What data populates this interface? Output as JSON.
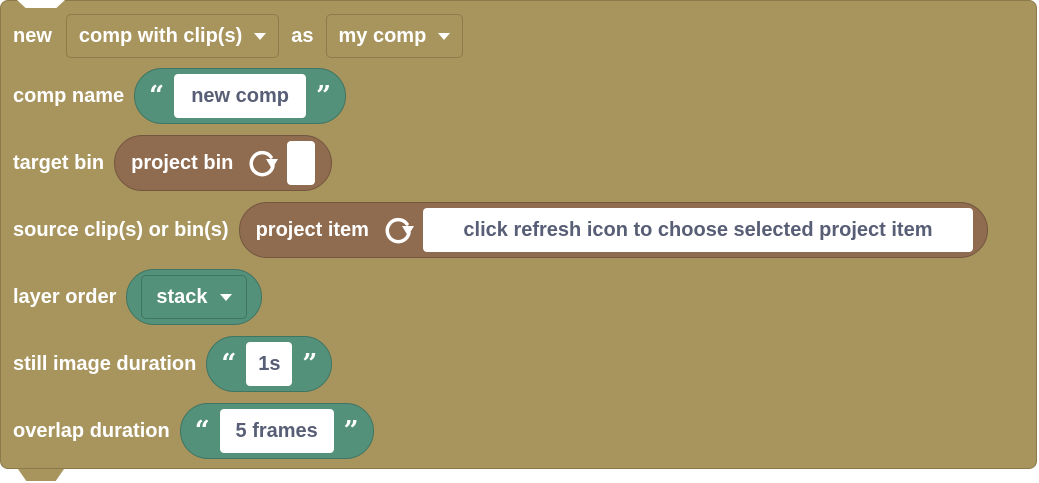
{
  "block": {
    "prefix": "new",
    "comp_type": "comp with clip(s)",
    "as_label": "as",
    "var_name": "my comp"
  },
  "comp_name": {
    "label": "comp name",
    "open_quote": "“",
    "value": "new comp",
    "close_quote": "”"
  },
  "target_bin": {
    "label": "target bin",
    "item_label": "project bin",
    "value": ""
  },
  "source": {
    "label": "source clip(s) or bin(s)",
    "item_label": "project item",
    "value": "click refresh icon to choose selected project item"
  },
  "layer_order": {
    "label": "layer order",
    "value": "stack"
  },
  "still_duration": {
    "label": "still image duration",
    "open_quote": "“",
    "value": "1s",
    "close_quote": "”"
  },
  "overlap_duration": {
    "label": "overlap duration",
    "open_quote": "“",
    "value": "5 frames",
    "close_quote": "”"
  },
  "icons": {
    "refresh": "refresh-icon",
    "caret": "caret-down-icon"
  },
  "colors": {
    "block": "#a8955e",
    "text_pill": "#54917b",
    "project_pill": "#8f6b4f",
    "input_text": "#575e75"
  }
}
